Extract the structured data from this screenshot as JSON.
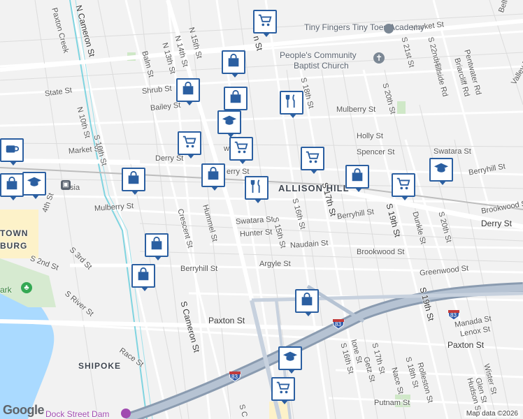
{
  "map": {
    "attribution": "Map data ©2026",
    "logo": "Google",
    "neighborhoods": {
      "allison_hill": "ALLISON HILL",
      "downtown": "TOWN",
      "downtown2": "BURG",
      "shipoke": "SHIPOKE"
    },
    "pois": {
      "academy": "Tiny Fingers Tiny Toes Academy",
      "church1": "People's Community",
      "church2": "Baptist Church",
      "dam": "Dock Street Dam",
      "park": "ark"
    },
    "streets": {
      "market_st_ne": "Market St",
      "state_st": "State St",
      "market_st_w": "Market St",
      "mulberry_st_e": "Mulberry St",
      "mulberry_st_w": "Mulberry St",
      "holly_st": "Holly St",
      "spencer_st": "Spencer St",
      "swatara_st_e": "Swatara St",
      "swatara_st_c": "Swatara St",
      "berryhill_st_e": "Berryhill St",
      "berryhill_st_c": "Berryhill St",
      "berryhill_st_w": "Berryhill St",
      "derry_st_w": "Derry St",
      "derry_st_c": "erry St",
      "derry_st_e": "Derry St",
      "brookwood_st_e": "Brookwood St",
      "brookwood_st_c": "Brookwood St",
      "hunter_st": "Hunter St",
      "naudain_st": "Naudain St",
      "argyle_st": "Argyle St",
      "greenwood_st": "Greenwood St",
      "paxton_st_w": "Paxton St",
      "paxton_st_e": "Paxton St",
      "manada_st": "Manada St",
      "lenox_st": "Lenox St",
      "putnam_st": "Putnam St",
      "shrub_st": "Shrub St",
      "bailey_st": "Bailey St",
      "hummel_st": "Hummel St",
      "crescent_st": "Crescent St",
      "race_st": "Race St",
      "s_river_st": "S River St",
      "s_2nd_st": "S 2nd St",
      "s_3rd_st": "S 3rd St",
      "paxton_creek": "Paxton Creek",
      "n_cameron_st": "N Cameron St",
      "s_cameron_st": "S Cameron St",
      "n_10th_st": "N 10th St",
      "s_10th_st": "S 10th St",
      "n_13th_st": "N 13th St",
      "n_14th_st": "N 14th St",
      "n_15th_st": "N 15th St",
      "balm_st": "Balm St",
      "s_15th_st": "S 15th St",
      "s_16th_st": "S 16th St",
      "s_17th_st": "S 17th St",
      "s_18th_st": "S 18th St",
      "s_19th_st": "S 19th St",
      "s_20th_st": "S 20th St",
      "s_21st_st": "S 21st St",
      "s_22nd_st": "S 22nd St",
      "dunkle_st": "Dunkle St",
      "hillside_rd": "Hillside Rd",
      "pentwater_rd": "Pentwater Rd",
      "briarcliff_rd": "Briarcliff Rd",
      "bellevue_rd": "Bellevue R",
      "valley_rd": "Valley R",
      "rolleston_st": "Rolleston St",
      "wister_st": "Wister St",
      "glen_st": "Glen St",
      "hudson_st": "Hudson St",
      "s_18th_st_s": "S 18th St",
      "nace_st": "Nace St",
      "ione_st": "Ione St",
      "s_16th_st_s": "S 16th St",
      "s_17th_st_s": "S 17th St",
      "getz_st": "Getz St",
      "s_14th_st_w": "4th St",
      "s_c_st": "S C",
      "n_13_mkt": "Market St",
      "s_18th_n": "S 18th St",
      "s_20th_n": "S 20th St",
      "s_16th_n": "S 16th St",
      "wer_st": "wer St",
      "n_an_st": "n St",
      "sia": "sia",
      "i83_a": "83",
      "i83_b": "83",
      "i83_c": "83"
    },
    "pins": [
      {
        "type": "shopping-cart"
      },
      {
        "type": "shopping-bag"
      },
      {
        "type": "shopping-bag"
      },
      {
        "type": "shopping-bag"
      },
      {
        "type": "restaurant"
      },
      {
        "type": "coffee"
      },
      {
        "type": "shopping-bag"
      },
      {
        "type": "shopping-bag"
      },
      {
        "type": "shopping-cart"
      },
      {
        "type": "school"
      },
      {
        "type": "shopping-cart"
      },
      {
        "type": "shopping-bag"
      },
      {
        "type": "restaurant"
      },
      {
        "type": "shopping-cart"
      },
      {
        "type": "shopping-bag"
      },
      {
        "type": "shopping-cart"
      },
      {
        "type": "school"
      },
      {
        "type": "shopping-bag"
      },
      {
        "type": "shopping-bag"
      },
      {
        "type": "shopping-bag"
      },
      {
        "type": "school"
      },
      {
        "type": "shopping-cart"
      },
      {
        "type": "school"
      }
    ]
  }
}
